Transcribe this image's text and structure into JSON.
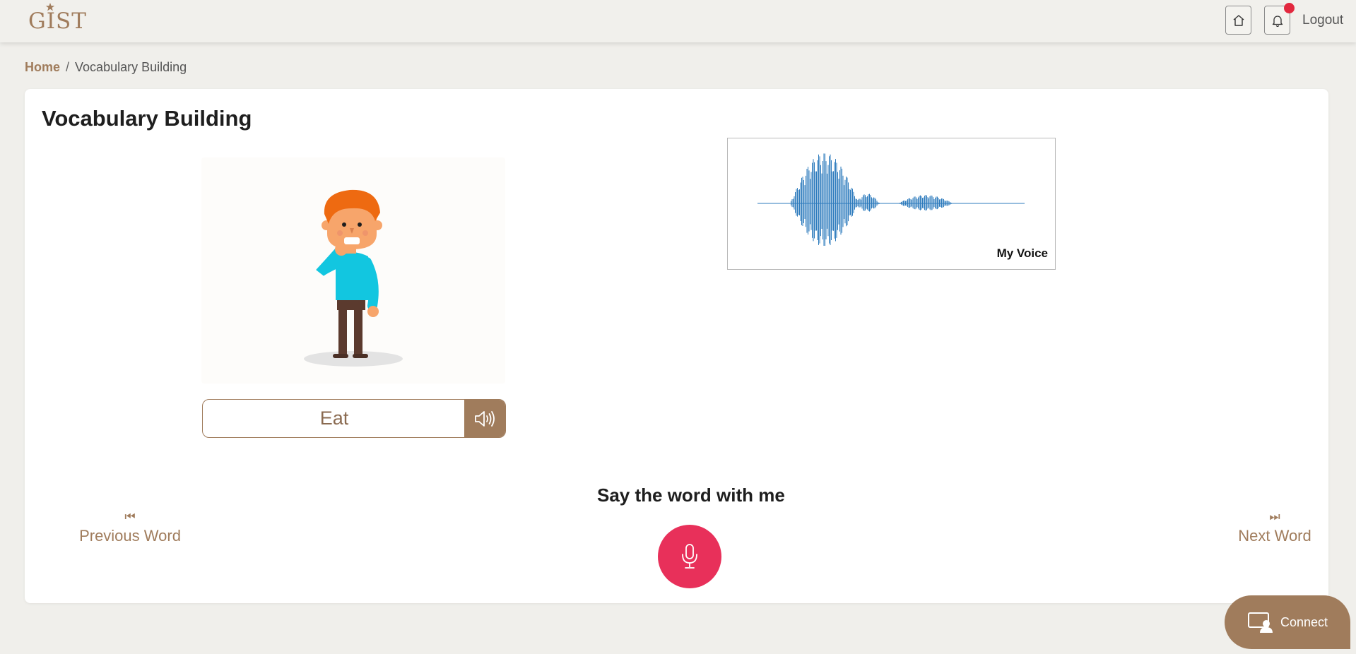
{
  "header": {
    "logo_text": "GIST",
    "logout_label": "Logout",
    "icons": {
      "home": "home-icon",
      "notifications": "bell-icon"
    }
  },
  "breadcrumb": {
    "home": "Home",
    "separator": "/",
    "current": "Vocabulary Building"
  },
  "main": {
    "title": "Vocabulary Building",
    "word": "Eat",
    "waveform_label": "My Voice",
    "prompt": "Say the word with me",
    "prev_label": "Previous Word",
    "next_label": "Next Word",
    "prev_glyph": "⏮",
    "next_glyph": "⏭"
  },
  "connect": {
    "label": "Connect"
  },
  "colors": {
    "accent": "#a07c5c",
    "mic": "#e8305a",
    "notification": "#e2283e",
    "waveform": "#2d7bbd"
  }
}
